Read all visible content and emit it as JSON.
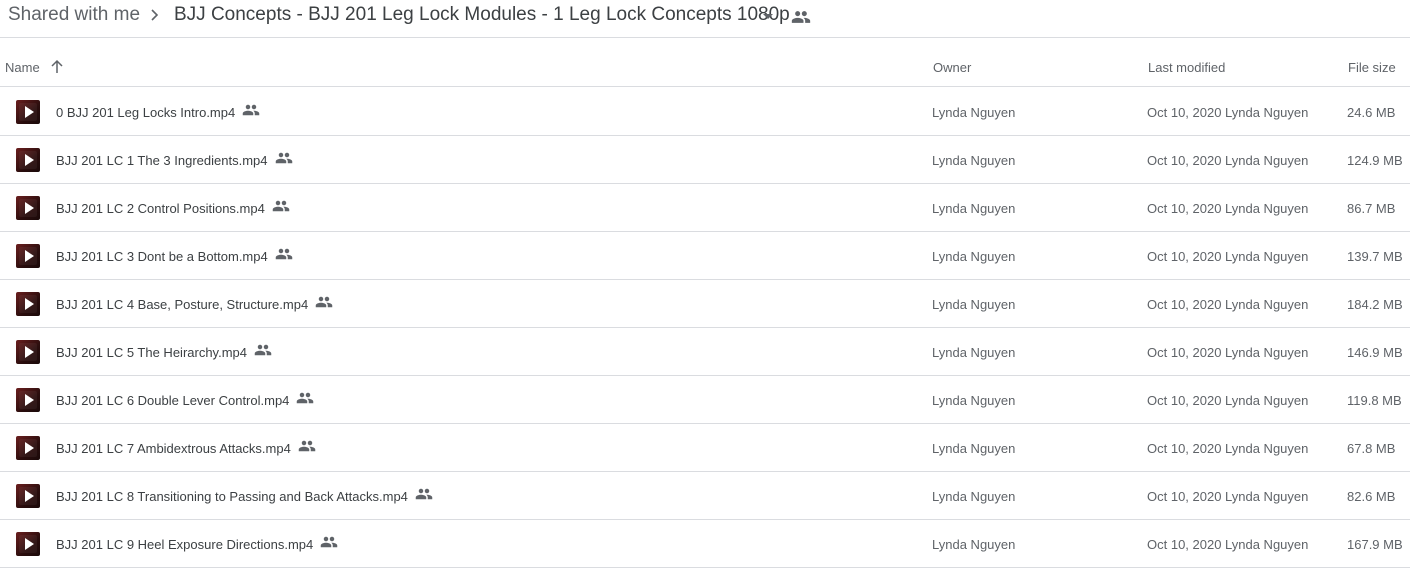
{
  "breadcrumb": {
    "root": "Shared with me",
    "current": "BJJ Concepts - BJJ 201 Leg Lock Modules - 1 Leg Lock Concepts 1080p",
    "shared_icon": "people-icon"
  },
  "table": {
    "columns": {
      "name": "Name",
      "owner": "Owner",
      "last_modified": "Last modified",
      "file_size": "File size"
    },
    "sort": "ascending",
    "rows": [
      {
        "name": "0 BJJ 201 Leg Locks Intro.mp4",
        "owner": "Lynda Nguyen",
        "date": "Oct 10, 2020",
        "by": "Lynda Nguyen",
        "size": "24.6 MB"
      },
      {
        "name": "BJJ 201 LC 1 The 3 Ingredients.mp4",
        "owner": "Lynda Nguyen",
        "date": "Oct 10, 2020",
        "by": "Lynda Nguyen",
        "size": "124.9 MB"
      },
      {
        "name": "BJJ 201 LC 2 Control Positions.mp4",
        "owner": "Lynda Nguyen",
        "date": "Oct 10, 2020",
        "by": "Lynda Nguyen",
        "size": "86.7 MB"
      },
      {
        "name": "BJJ 201 LC 3 Dont be a Bottom.mp4",
        "owner": "Lynda Nguyen",
        "date": "Oct 10, 2020",
        "by": "Lynda Nguyen",
        "size": "139.7 MB"
      },
      {
        "name": "BJJ 201 LC 4 Base, Posture, Structure.mp4",
        "owner": "Lynda Nguyen",
        "date": "Oct 10, 2020",
        "by": "Lynda Nguyen",
        "size": "184.2 MB"
      },
      {
        "name": "BJJ 201 LC 5 The Heirarchy.mp4",
        "owner": "Lynda Nguyen",
        "date": "Oct 10, 2020",
        "by": "Lynda Nguyen",
        "size": "146.9 MB"
      },
      {
        "name": "BJJ 201 LC 6 Double Lever Control.mp4",
        "owner": "Lynda Nguyen",
        "date": "Oct 10, 2020",
        "by": "Lynda Nguyen",
        "size": "119.8 MB"
      },
      {
        "name": "BJJ 201 LC 7 Ambidextrous Attacks.mp4",
        "owner": "Lynda Nguyen",
        "date": "Oct 10, 2020",
        "by": "Lynda Nguyen",
        "size": "67.8 MB"
      },
      {
        "name": "BJJ 201 LC 8 Transitioning to Passing and Back Attacks.mp4",
        "owner": "Lynda Nguyen",
        "date": "Oct 10, 2020",
        "by": "Lynda Nguyen",
        "size": "82.6 MB"
      },
      {
        "name": "BJJ 201 LC 9 Heel Exposure Directions.mp4",
        "owner": "Lynda Nguyen",
        "date": "Oct 10, 2020",
        "by": "Lynda Nguyen",
        "size": "167.9 MB"
      }
    ]
  },
  "colors": {
    "text": "#3c4043",
    "secondary_text": "#5f6368",
    "divider": "#dadce0",
    "thumb": "#6b1f1f"
  }
}
